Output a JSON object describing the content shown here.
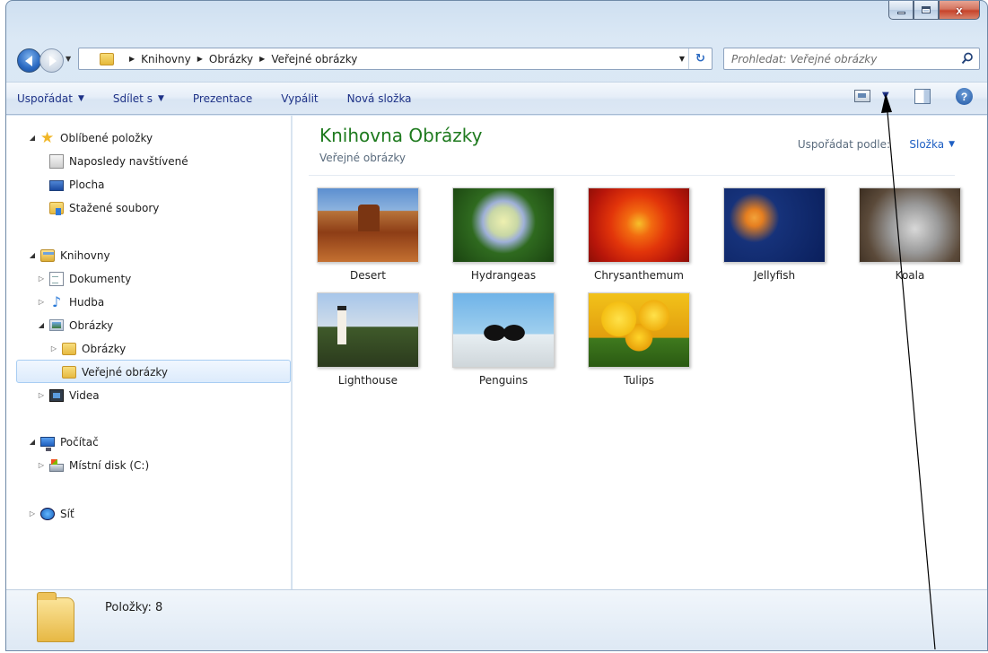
{
  "window": {
    "caption": {
      "minimize": "–",
      "maximize": "□",
      "close": "x"
    }
  },
  "navigation": {
    "breadcrumbs": [
      "Knihovny",
      "Obrázky",
      "Veřejné obrázky"
    ],
    "search_placeholder": "Prohledat: Veřejné obrázky"
  },
  "toolbar": {
    "commands": [
      {
        "label": "Uspořádat",
        "has_dropdown": true
      },
      {
        "label": "Sdílet s",
        "has_dropdown": true
      },
      {
        "label": "Prezentace",
        "has_dropdown": false
      },
      {
        "label": "Vypálit",
        "has_dropdown": false
      },
      {
        "label": "Nová složka",
        "has_dropdown": false
      }
    ],
    "help_label": "?"
  },
  "sidebar": {
    "favorites": {
      "label": "Oblíbené položky",
      "items": [
        "Naposledy navštívené",
        "Plocha",
        "Stažené soubory"
      ]
    },
    "libraries": {
      "label": "Knihovny",
      "items": [
        "Dokumenty",
        "Hudba",
        "Obrázky",
        "Obrázky",
        "Veřejné obrázky",
        "Videa"
      ]
    },
    "computer": {
      "label": "Počítač",
      "items": [
        "Místní disk (C:)"
      ]
    },
    "network": {
      "label": "Síť"
    }
  },
  "content": {
    "title": "Knihovna Obrázky",
    "subtitle": "Veřejné obrázky",
    "arrange_label": "Uspořádat podle:",
    "arrange_value": "Složka",
    "images": [
      "Desert",
      "Hydrangeas",
      "Chrysanthemum",
      "Jellyfish",
      "Koala",
      "Lighthouse",
      "Penguins",
      "Tulips"
    ]
  },
  "details": {
    "items_count": "Položky: 8"
  },
  "colors": {
    "library_title": "#1e7a1e",
    "command_text": "#1e3287",
    "selection_border": "#a8cdf3"
  }
}
